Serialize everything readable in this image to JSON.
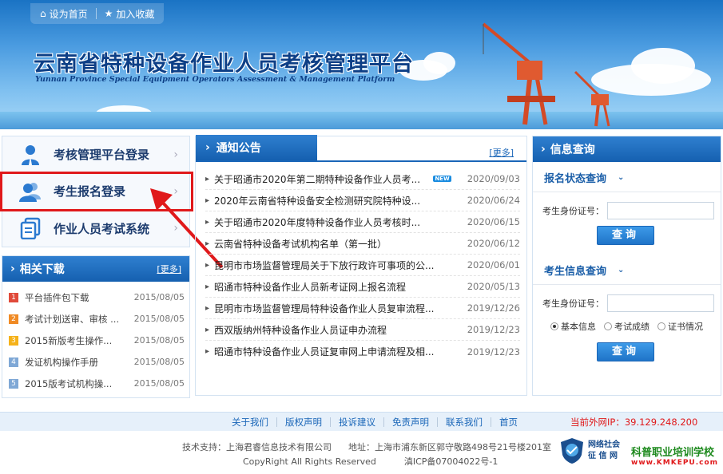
{
  "header": {
    "set_home": "设为首页",
    "add_fav": "加入收藏",
    "title_cn": "云南省特种设备作业人员考核管理平台",
    "title_en": "Yunnan Province Special Equipment Operators Assessment & Management Platform"
  },
  "login": {
    "items": [
      {
        "label": "考核管理平台登录",
        "icon": "admin-user-icon"
      },
      {
        "label": "考生报名登录",
        "icon": "users-icon"
      },
      {
        "label": "作业人员考试系统",
        "icon": "exam-doc-icon"
      }
    ]
  },
  "downloads": {
    "title": "相关下载",
    "more": "[更多]",
    "items": [
      {
        "num": "1",
        "title": "平台插件包下载",
        "date": "2015/08/05",
        "color": "#e04a3a"
      },
      {
        "num": "2",
        "title": "考试计划送审、审核 ...",
        "date": "2015/08/05",
        "color": "#f08a24"
      },
      {
        "num": "3",
        "title": "2015新版考生操作...",
        "date": "2015/08/05",
        "color": "#f5b21a"
      },
      {
        "num": "4",
        "title": "发证机构操作手册",
        "date": "2015/08/05",
        "color": "#7fa8d6"
      },
      {
        "num": "5",
        "title": "2015版考试机构操...",
        "date": "2015/08/05",
        "color": "#7fa8d6"
      }
    ]
  },
  "notices": {
    "title": "通知公告",
    "more": "[更多]",
    "new_badge": "NEW",
    "items": [
      {
        "title": "关于昭通市2020年第二期特种设备作业人员考...",
        "date": "2020/09/03",
        "is_new": true
      },
      {
        "title": "2020年云南省特种设备安全检测研究院特种设...",
        "date": "2020/06/24",
        "is_new": false
      },
      {
        "title": "关于昭通市2020年度特种设备作业人员考核时...",
        "date": "2020/06/15",
        "is_new": false
      },
      {
        "title": "云南省特种设备考试机构名单（第一批）",
        "date": "2020/06/12",
        "is_new": false
      },
      {
        "title": "昆明市市场监督管理局关于下放行政许可事项的公...",
        "date": "2020/06/01",
        "is_new": false
      },
      {
        "title": "昭通市特种设备作业人员新考证网上报名流程",
        "date": "2020/05/13",
        "is_new": false
      },
      {
        "title": "昆明市市场监督管理局特种设备作业人员复审流程...",
        "date": "2019/12/26",
        "is_new": false
      },
      {
        "title": "西双版纳州特种设备作业人员证申办流程",
        "date": "2019/12/23",
        "is_new": false
      },
      {
        "title": "昭通市特种设备作业人员证复审网上申请流程及相...",
        "date": "2019/12/23",
        "is_new": false
      }
    ]
  },
  "info_query": {
    "title": "信息查询",
    "status_query": {
      "title": "报名状态查询",
      "id_label": "考生身份证号：",
      "id_value": "",
      "button": "查询"
    },
    "info_query": {
      "title": "考生信息查询",
      "id_label": "考生身份证号：",
      "id_value": "",
      "options": [
        "基本信息",
        "考试成绩",
        "证书情况"
      ],
      "selected": "基本信息",
      "button": "查询"
    }
  },
  "footer": {
    "links": [
      "关于我们",
      "版权声明",
      "投诉建议",
      "免责声明",
      "联系我们",
      "首页"
    ],
    "ip": "当前外网IP：39.129.248.200",
    "support": "技术支持：上海君睿信息技术有限公司      地址：上海市浦东新区郭守敬路498号21号楼201室",
    "copyright": "CopyRight All Rights Reserved          滇ICP备07004022号-1",
    "badge_line1": "网络社会",
    "badge_line2": "征 信 网",
    "school_name": "科普职业培训学校",
    "school_url": "www.KMKEPU.com"
  }
}
